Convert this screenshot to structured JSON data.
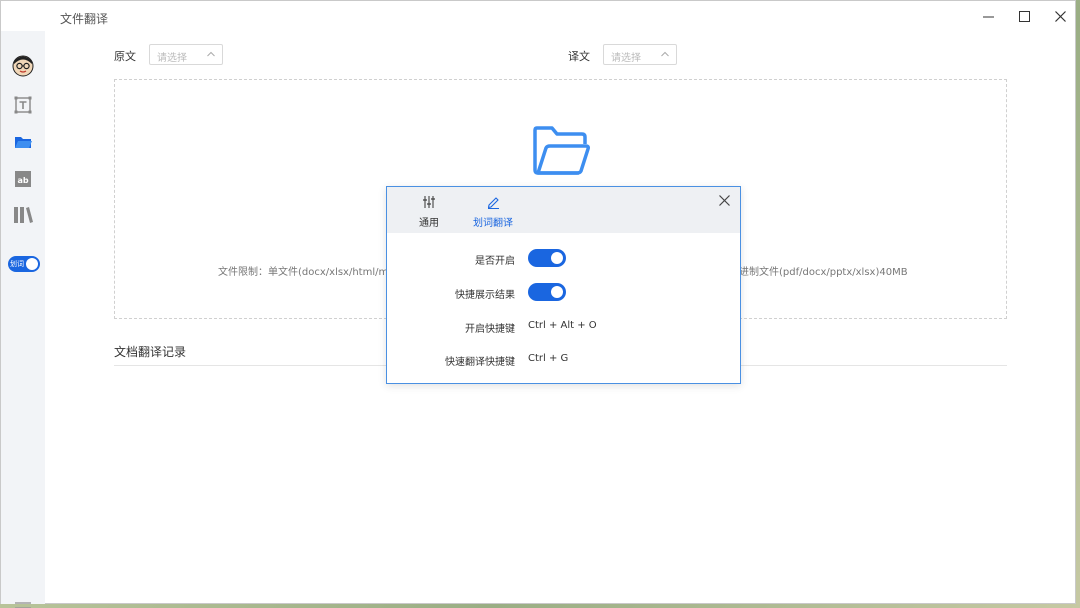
{
  "window": {
    "title": "文件翻译"
  },
  "sidebar": {
    "items": [
      {
        "name": "avatar"
      },
      {
        "name": "text-translate-icon"
      },
      {
        "name": "folder-icon"
      },
      {
        "name": "image-translate-icon"
      },
      {
        "name": "library-icon"
      }
    ],
    "word_select_toggle_label": "划词"
  },
  "languages": {
    "source_label": "原文",
    "source_placeholder": "请选择",
    "target_label": "译文",
    "target_placeholder": "请选择"
  },
  "dropzone": {
    "limit_left": "文件限制：单文件(docx/xlsx/html/ma",
    "limit_right": "进制文件(pdf/docx/pptx/xlsx)40MB"
  },
  "history": {
    "title": "文档翻译记录"
  },
  "dialog": {
    "tabs": [
      {
        "label": "通用",
        "icon": "sliders-icon",
        "active": false
      },
      {
        "label": "划词翻译",
        "icon": "pen-icon",
        "active": true
      }
    ],
    "settings": [
      {
        "label": "是否开启",
        "type": "switch",
        "on": true
      },
      {
        "label": "快捷展示结果",
        "type": "switch",
        "on": true
      },
      {
        "label": "开启快捷键",
        "type": "text",
        "value": "Ctrl + Alt + O"
      },
      {
        "label": "快速翻译快捷键",
        "type": "text",
        "value": "Ctrl + G"
      }
    ]
  },
  "colors": {
    "accent": "#1a66e0",
    "dialog_border": "#4a90e2",
    "folder": "#3d8ef0"
  }
}
